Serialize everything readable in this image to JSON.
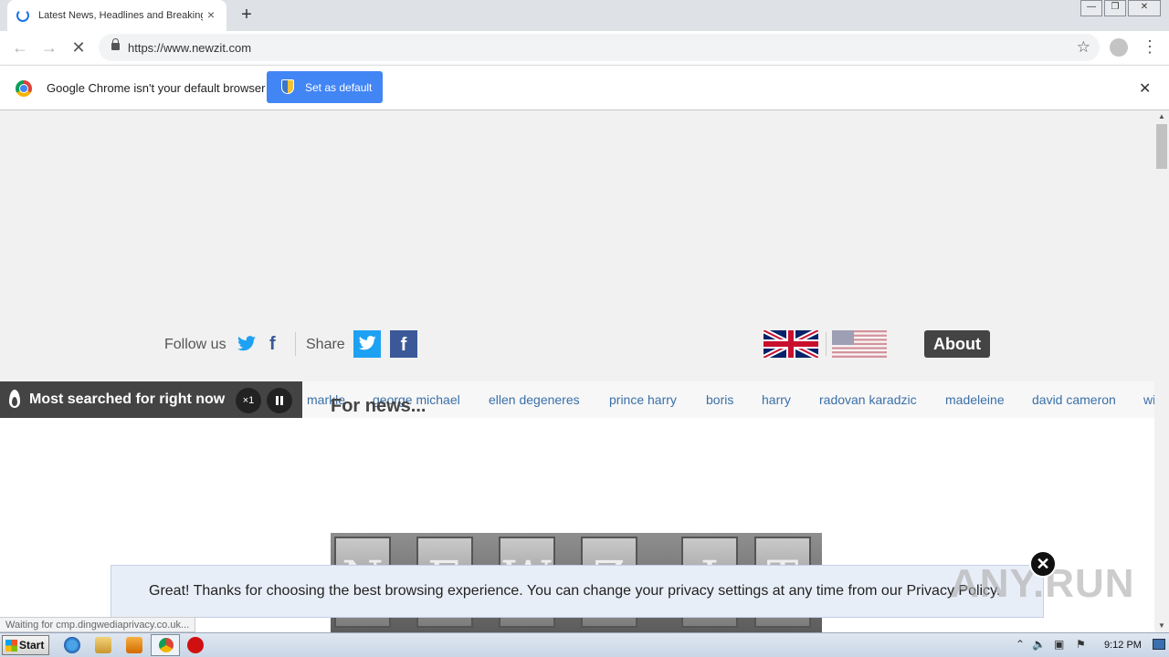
{
  "browser": {
    "tab_title": "Latest News, Headlines and Breaking",
    "tab_close": "×",
    "new_tab": "+",
    "url": "https://www.newzit.com",
    "window_min": "—",
    "window_restore": "❐",
    "window_close": "✕",
    "star": "☆",
    "menu": "⋮"
  },
  "infobar": {
    "message": "Google Chrome isn't your default browser",
    "button": "Set as default",
    "close": "✕"
  },
  "trending": {
    "label": "Most searched for right now",
    "speed": "×1",
    "items": [
      "markle",
      "george michael",
      "ellen degeneres",
      "prince harry",
      "boris",
      "harry",
      "radovan karadzic",
      "madeleine",
      "david cameron",
      "wi"
    ]
  },
  "social": {
    "follow": "Follow us",
    "share": "Share",
    "fb_letter": "f"
  },
  "about": "About",
  "news_heading": "For news...",
  "banner_letters": [
    "N",
    "E",
    "W",
    "Z",
    "I",
    "T"
  ],
  "cookie": {
    "text": "Great! Thanks for choosing the best browsing experience. You can change your privacy settings at any time from our Privacy Policy.",
    "close": "✕"
  },
  "watermark": "ANY.RUN",
  "status": "Waiting for cmp.dingwediaprivacy.co.uk...",
  "taskbar": {
    "start": "Start",
    "clock": "9:12 PM"
  },
  "colors": {
    "accent": "#4285f4",
    "trend_link": "#3a6fa8",
    "trend_bar": "#444444"
  }
}
